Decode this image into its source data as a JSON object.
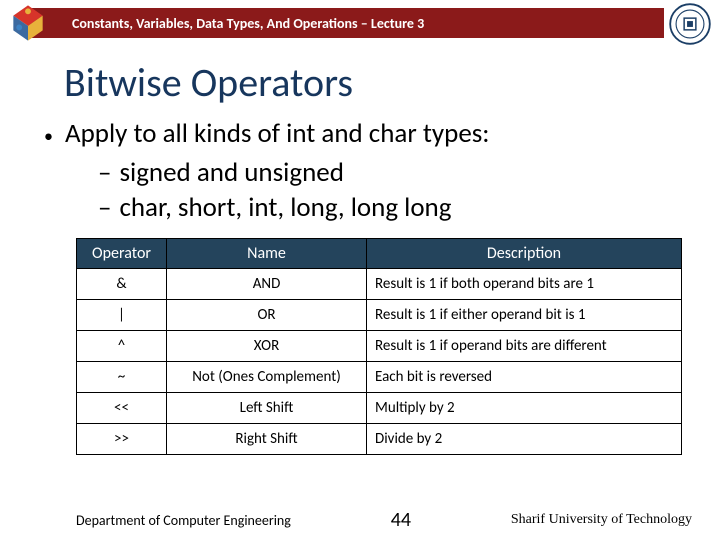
{
  "header": {
    "strip": "Constants, Variables, Data Types, And Operations – Lecture 3"
  },
  "title": "Bitwise Operators",
  "bullets": {
    "main": "Apply to all kinds of int and char types:",
    "sub1": "signed and unsigned",
    "sub2": "char, short, int, long, long long"
  },
  "table": {
    "headers": {
      "op": "Operator",
      "name": "Name",
      "desc": "Description"
    },
    "rows": [
      {
        "op": "&",
        "name": "AND",
        "desc": "Result is 1 if both operand bits are 1"
      },
      {
        "op": "|",
        "name": "OR",
        "desc": "Result is 1 if either operand bit is 1"
      },
      {
        "op": "^",
        "name": "XOR",
        "desc": "Result is 1 if operand bits are different"
      },
      {
        "op": "~",
        "name": "Not (Ones Complement)",
        "desc": "Each bit is reversed"
      },
      {
        "op": "<<",
        "name": "Left Shift",
        "desc": "Multiply by 2"
      },
      {
        "op": ">>",
        "name": "Right Shift",
        "desc": "Divide by 2"
      }
    ]
  },
  "footer": {
    "dept": "Department of Computer Engineering",
    "page": "44",
    "univ": "Sharif University of Technology"
  }
}
